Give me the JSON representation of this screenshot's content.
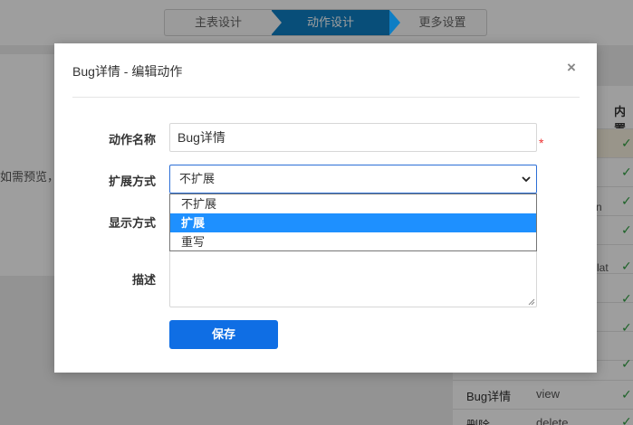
{
  "steps": {
    "items": [
      "主表设计",
      "动作设计",
      "更多设置"
    ],
    "active_index": 1
  },
  "background": {
    "left_hint": "如需预览，",
    "table_header": "内置",
    "rows": [
      {
        "name": "Bug详情",
        "code": "view"
      },
      {
        "name": "删除",
        "code": "delete"
      }
    ],
    "fragments": [
      "n",
      "lat"
    ]
  },
  "modal": {
    "title": "Bug详情 - 编辑动作",
    "close_icon": "close-icon",
    "fields": {
      "name_label": "动作名称",
      "name_value": "Bug详情",
      "required_mark": "*",
      "ext_label": "扩展方式",
      "ext_value": "不扩展",
      "display_label": "显示方式",
      "desc_label": "描述"
    },
    "dropdown_options": [
      "不扩展",
      "扩展",
      "重写"
    ],
    "dropdown_highlighted": "扩展",
    "save_label": "保存"
  },
  "colors": {
    "accent": "#0f6ee4",
    "step_active": "#0e7ec4",
    "highlight": "#1e90ff",
    "required": "#ee3333",
    "check": "#2e9e3f"
  }
}
